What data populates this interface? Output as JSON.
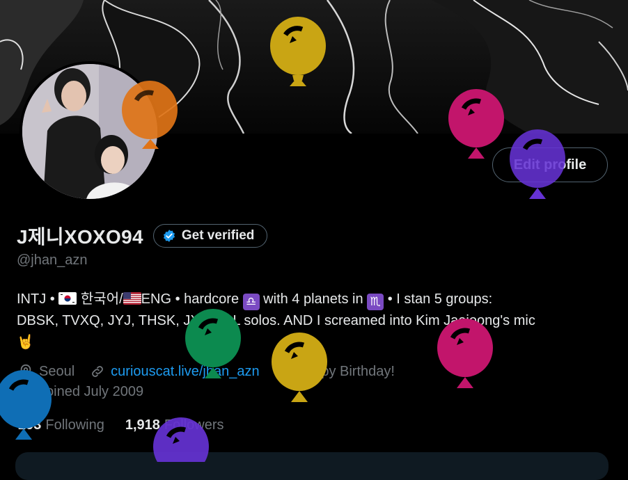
{
  "profile": {
    "display_name": "J제니XOXO94",
    "verify_label": "Get verified",
    "handle": "@jhan_azn",
    "edit_label": "Edit profile",
    "bio": {
      "p1": "INTJ • ",
      "p2": " 한국어/",
      "p3": "ENG • hardcore ",
      "libra": "♎",
      "p4": " with 4 planets in ",
      "scorpio": "♏",
      "p5": " • I stan 5 groups:",
      "line2": "DBSK, TVXQ, JYJ, THSK, JX & ALL  solos. AND I screamed into Kim Jaejoong's mic",
      "hand": "🤘"
    },
    "location": "Seoul",
    "website": "curiouscat.live/jhan_azn",
    "birthday": "Happy Birthday!",
    "joined": "Joined July 2009",
    "following_count": "293",
    "following_label": "Following",
    "followers_count": "1,918",
    "followers_label": "Followers"
  },
  "icons": {
    "location": "location-pin-icon",
    "link": "link-icon",
    "birthday": "balloon-icon",
    "joined": "calendar-icon",
    "verified": "verified-badge-icon"
  },
  "colors": {
    "accent": "#1d9bf0",
    "text": "#e7e9ea",
    "muted": "#71767b",
    "balloon_yellow": "#c9a514",
    "balloon_orange": "#e07417",
    "balloon_magenta": "#c2156b",
    "balloon_purple": "#6532d4",
    "balloon_green": "#0c8a4f",
    "balloon_blue": "#0f6eb5"
  }
}
